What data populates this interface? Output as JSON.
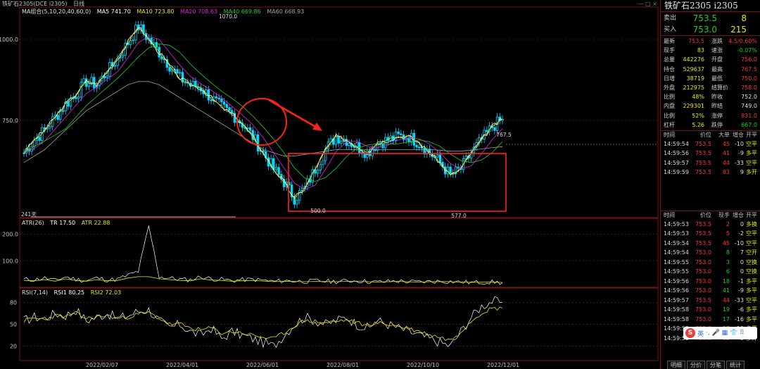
{
  "topbar": {
    "title": "铁矿石2305(DCE i2305)",
    "period": "日线",
    "controls": "— □ ×"
  },
  "main_legend": {
    "ma_group": "MA组合(5,10,20,40,60,0)",
    "ma5": "MA5 741.70",
    "ma10": "MA10 723.80",
    "ma20": "MA20 708.63",
    "ma40": "MA40 669.86",
    "ma60": "MA60 668.93"
  },
  "atr_legend": {
    "name": "ATR(26)",
    "tr": "TR 17.50",
    "atr": "ATR 22.88"
  },
  "rsi_legend": {
    "name": "RSI(7,14)",
    "rsi1": "RSI1 80.25",
    "rsi2": "RSI2 72.03"
  },
  "annotations": {
    "high_label": "1070.0",
    "low_label_1": "500.0",
    "low_label_2": "577.0",
    "last_high_label": "767.5",
    "days_label": "241天"
  },
  "colors": {
    "up": "#00d8ff",
    "down": "#00d8ff",
    "ma5": "#ffffff",
    "ma10": "#e8e800",
    "ma20": "#e020e0",
    "ma40": "#20d020",
    "ma60": "#a0a0a0",
    "frame": "#7a1414",
    "annotation": "#ff2020"
  },
  "chart_data": {
    "type": "candlestick",
    "x_ticks": [
      "2022/02/07",
      "2022/04/01",
      "2022/06/01",
      "2022/08/01",
      "2022/10/10",
      "2022/12/01"
    ],
    "main_y_ticks": [
      1000.0,
      750.0
    ],
    "atr_y_ticks": [
      200.0,
      100.0
    ],
    "rsi_y_ticks": [
      80,
      50,
      20
    ],
    "close_path": [
      650,
      690,
      720,
      760,
      800,
      830,
      870,
      860,
      900,
      940,
      990,
      1040,
      1000,
      960,
      920,
      880,
      860,
      850,
      820,
      790,
      770,
      740,
      700,
      650,
      600,
      560,
      510,
      540,
      600,
      660,
      700,
      690,
      670,
      650,
      680,
      690,
      700,
      700,
      680,
      650,
      620,
      580,
      600,
      650,
      690,
      730,
      753.5
    ],
    "ma60_path": [
      620,
      640,
      660,
      690,
      720,
      750,
      780,
      800,
      820,
      840,
      860,
      870,
      870,
      860,
      840,
      820,
      800,
      780,
      760,
      740,
      720,
      700,
      680,
      660,
      650,
      640,
      640,
      645,
      650,
      655,
      660,
      660,
      660,
      660,
      660,
      660,
      660,
      660,
      660,
      660,
      658,
      655,
      655,
      658,
      662,
      666,
      669
    ],
    "rsi1_path": [
      55,
      60,
      58,
      65,
      62,
      70,
      55,
      60,
      65,
      58,
      62,
      68,
      70,
      55,
      45,
      50,
      40,
      35,
      45,
      30,
      40,
      35,
      30,
      25,
      20,
      35,
      50,
      60,
      55,
      50,
      55,
      60,
      50,
      45,
      55,
      50,
      45,
      40,
      35,
      30,
      25,
      20,
      40,
      60,
      75,
      82,
      80.25
    ],
    "rsi2_path": [
      55,
      58,
      57,
      62,
      60,
      65,
      58,
      60,
      62,
      58,
      60,
      64,
      66,
      58,
      50,
      50,
      45,
      42,
      45,
      38,
      40,
      38,
      35,
      32,
      30,
      38,
      48,
      55,
      54,
      52,
      54,
      56,
      52,
      48,
      52,
      50,
      47,
      44,
      40,
      36,
      32,
      28,
      40,
      55,
      66,
      72,
      72.03
    ],
    "atr_path": [
      30,
      28,
      35,
      25,
      40,
      30,
      25,
      35,
      28,
      30,
      45,
      60,
      230,
      40,
      35,
      30,
      28,
      40,
      32,
      30,
      25,
      28,
      30,
      26,
      22,
      25,
      24,
      22,
      24,
      23,
      22,
      24,
      25,
      22,
      20,
      22,
      24,
      21,
      20,
      22,
      23,
      22,
      20,
      18,
      19,
      20,
      17.5
    ]
  },
  "panel": {
    "title": "铁矿石2305 i2305",
    "ask": {
      "label": "卖出",
      "price": "753.5",
      "volume": "8"
    },
    "bid": {
      "label": "买入",
      "price": "753.0",
      "volume": "215"
    },
    "stats": [
      {
        "k1": "最新",
        "v1": "753.5",
        "c1": "red",
        "k2": "涨跌",
        "v2": "4.5/0.60%",
        "c2": "red"
      },
      {
        "k1": "现手",
        "v1": "83",
        "c1": "yellow",
        "k2": "速涨",
        "v2": "-0.07%",
        "c2": "green"
      },
      {
        "k1": "总量",
        "v1": "442276",
        "c1": "yellow",
        "k2": "开盘",
        "v2": "756.0",
        "c2": "red"
      },
      {
        "k1": "持仓",
        "v1": "529637",
        "c1": "yellow",
        "k2": "最高",
        "v2": "767.5",
        "c2": "red"
      },
      {
        "k1": "日增",
        "v1": "38719",
        "c1": "yellow",
        "k2": "最低",
        "v2": "750.0",
        "c2": "red"
      },
      {
        "k1": "外盘",
        "v1": "212975",
        "c1": "yellow",
        "k2": "结算价",
        "v2": "758.0",
        "c2": "red"
      },
      {
        "k1": "比例",
        "v1": "48%",
        "c1": "yellow",
        "k2": "昨收",
        "v2": "752.0",
        "c2": "white"
      },
      {
        "k1": "内盘",
        "v1": "229301",
        "c1": "yellow",
        "k2": "昨结",
        "v2": "749.0",
        "c2": "white"
      },
      {
        "k1": "比例",
        "v1": "52%",
        "c1": "yellow",
        "k2": "涨停",
        "v2": "831.0",
        "c2": "red"
      },
      {
        "k1": "杠杆",
        "v1": "5.26",
        "c1": "yellow",
        "k2": "跌停",
        "v2": "667.0",
        "c2": "green"
      }
    ],
    "tick_headers_1": {
      "time": "时间",
      "price": "价位",
      "vol": "大单",
      "chg": "增仓",
      "type": "开平"
    },
    "ticks_1": [
      {
        "time": "14:59:54",
        "price": "753.5",
        "vol": "45",
        "vc": "red",
        "chg": "-10",
        "type": "空平",
        "tc": "yellow"
      },
      {
        "time": "14:59:56",
        "price": "753.5",
        "vol": "41",
        "vc": "red",
        "chg": "-9",
        "type": "多平",
        "tc": "yellow"
      },
      {
        "time": "14:59:57",
        "price": "753.5",
        "vol": "44",
        "vc": "red",
        "chg": "-33",
        "type": "空平",
        "tc": "yellow"
      },
      {
        "time": "14:59:59",
        "price": "753.5",
        "vol": "83",
        "vc": "red",
        "chg": "9",
        "type": "多开",
        "tc": "yellow"
      }
    ],
    "tick_headers_2": {
      "time": "时间",
      "price": "价位",
      "vol": "现手",
      "chg": "增仓",
      "type": "开平"
    },
    "ticks_2": [
      {
        "time": "14:59:53",
        "price": "753.5",
        "vol": "2",
        "vc": "red",
        "chg": "0",
        "type": "多换",
        "tc": "yellow"
      },
      {
        "time": "14:59:53",
        "price": "753.5",
        "vol": "5",
        "vc": "red",
        "chg": "-2",
        "type": "空平",
        "tc": "yellow"
      },
      {
        "time": "14:59:54",
        "price": "753.5",
        "vol": "45",
        "vc": "red",
        "chg": "-10",
        "type": "空平",
        "tc": "yellow"
      },
      {
        "time": "14:59:54",
        "price": "753.0",
        "vol": "8",
        "vc": "green",
        "chg": "7",
        "type": "空开",
        "tc": "yellow"
      },
      {
        "time": "14:59:55",
        "price": "753.0",
        "vol": "3",
        "vc": "green",
        "chg": "0",
        "type": "空换",
        "tc": "yellow"
      },
      {
        "time": "14:59:55",
        "price": "753.0",
        "vol": "6",
        "vc": "green",
        "chg": "0",
        "type": "空换",
        "tc": "yellow"
      },
      {
        "time": "14:59:56",
        "price": "753.0",
        "vol": "18",
        "vc": "green",
        "chg": "-1",
        "type": "多平",
        "tc": "yellow"
      },
      {
        "time": "14:59:56",
        "price": "753.0",
        "vol": "41",
        "vc": "green",
        "chg": "-9",
        "type": "多平",
        "tc": "yellow"
      },
      {
        "time": "14:59:57",
        "price": "753.5",
        "vol": "44",
        "vc": "red",
        "chg": "-33",
        "type": "空平",
        "tc": "yellow"
      },
      {
        "time": "14:59:58",
        "price": "753.0",
        "vol": "19",
        "vc": "green",
        "chg": "-6",
        "type": "多平",
        "tc": "yellow"
      },
      {
        "time": "14:59:58",
        "price": "753.0",
        "vol": "17",
        "vc": "green",
        "chg": "-16",
        "type": "多平",
        "tc": "yellow"
      },
      {
        "time": "14:59:59",
        "price": "753.0",
        "vol": "27",
        "vc": "green",
        "chg": "-10",
        "type": "多平",
        "tc": "yellow"
      },
      {
        "time": "14:59:59",
        "price": "753.5",
        "vol": "83",
        "vc": "red",
        "chg": "9",
        "type": "多开",
        "tc": "yellow"
      }
    ],
    "bottom_tabs": [
      "明细",
      "分价",
      "分笔",
      "统计"
    ],
    "ime": {
      "logo": "S",
      "lang": "英",
      "items": "·, 🎤 ▦ 👕 ⠿"
    }
  }
}
